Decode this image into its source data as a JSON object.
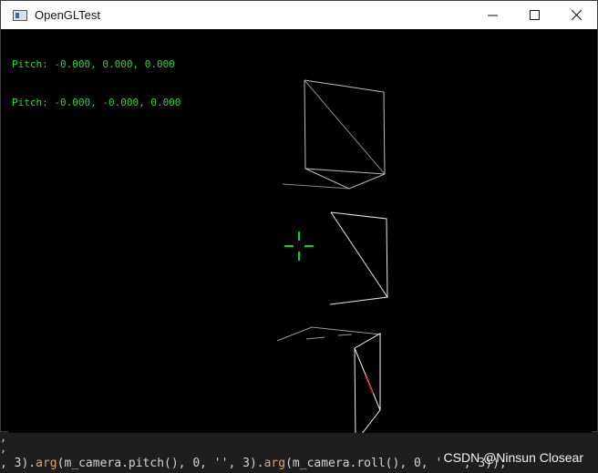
{
  "window": {
    "title": "OpenGLTest",
    "icon": "app-window-icon",
    "controls": [
      "minimize-icon",
      "maximize-icon",
      "close-icon"
    ]
  },
  "overlay": {
    "lines": [
      "Pitch: -0.000, 0.000, 0.000",
      "Pitch: -0.000, -0.000, 0.000"
    ],
    "color": "#2fd52f"
  },
  "scene": {
    "crosshair_color": "#00e000",
    "wire_color": "#e0e0e0",
    "highlight_color": "#c00000"
  },
  "editor": {
    "gutter": ",",
    "code_prefix": ", 3).",
    "code_fn1": "arg",
    "code_mid": "(m_camera.pitch(), 0, '",
    "code_mid2": "', 3).",
    "code_fn2": "arg",
    "code_end": "(m_camera.roll(), 0, '  ', 3));"
  },
  "watermark": "CSDN @Ninsun Closear"
}
